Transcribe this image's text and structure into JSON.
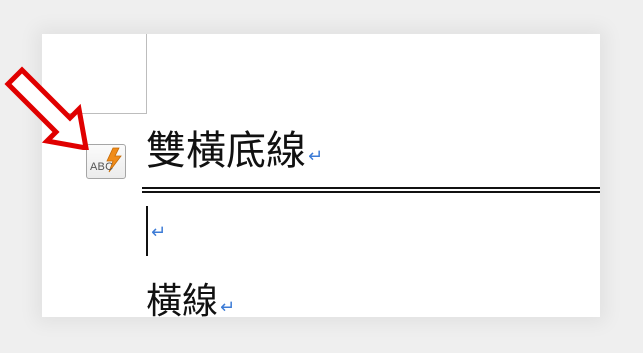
{
  "document": {
    "heading": "雙橫底線",
    "heading_mark": "↵",
    "empty_mark": "↵",
    "subheading": "橫線",
    "subheading_mark": "↵"
  },
  "autocorrect_button": {
    "label": "ABC",
    "icon": "lightning-bolt-icon"
  },
  "annotation": {
    "icon": "callout-arrow-icon",
    "color": "#e00000"
  },
  "colors": {
    "paragraph_mark": "#3c7bd6",
    "arrow": "#e00000",
    "bolt": "#f08c1a"
  }
}
